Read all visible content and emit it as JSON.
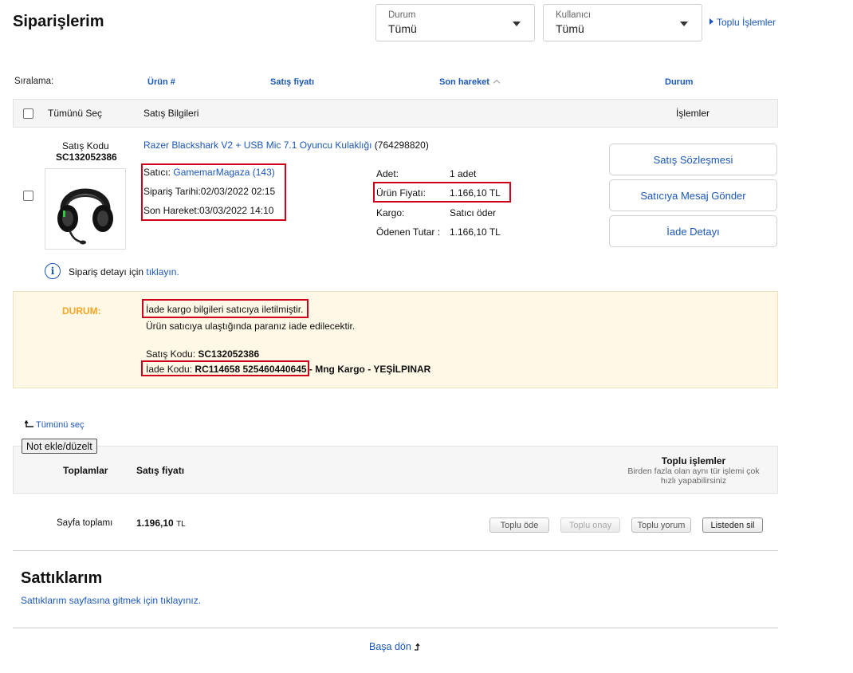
{
  "header": {
    "title": "Siparişlerim",
    "status_filter": {
      "label": "Durum",
      "value": "Tümü"
    },
    "user_filter": {
      "label": "Kullanıcı",
      "value": "Tümü"
    },
    "bulk_actions_link": "Toplu İşlemler"
  },
  "sorting": {
    "label": "Sıralama:",
    "columns": [
      "Ürün #",
      "Satış fiyatı",
      "Son hareket",
      "Durum"
    ]
  },
  "table_header": {
    "select_all": "Tümünü Seç",
    "sale_info": "Satış Bilgileri",
    "actions": "İşlemler"
  },
  "order": {
    "sale_code_label": "Satış Kodu",
    "sale_code": "SC132052386",
    "product_title": "Razer Blackshark V2 + USB Mic 7.1 Oyuncu Kulaklığı",
    "product_id": "(764298820)",
    "seller_label": "Satıcı:",
    "seller_name": "GamemarMagaza (143)",
    "order_date": "Sipariş Tarihi:02/03/2022 02:15",
    "last_action": "Son Hareket:03/03/2022 14:10",
    "details": [
      {
        "label": "Adet:",
        "value": "1 adet"
      },
      {
        "label": "Ürün Fiyatı:",
        "value": "1.166,10 TL"
      },
      {
        "label": "Kargo:",
        "value": "Satıcı öder"
      },
      {
        "label": "Ödenen Tutar :",
        "value": "1.166,10 TL"
      }
    ],
    "buttons": [
      "Satış Sözleşmesi",
      "Satıcıya Mesaj Gönder",
      "İade Detayı"
    ],
    "detail_prompt": "Sipariş detayı için",
    "detail_link": "tıklayın."
  },
  "status": {
    "label": "DURUM:",
    "line1": "İade kargo bilgileri satıcıya iletilmiştir.",
    "line2": "Ürün satıcıya ulaştığında paranız iade edilecektir.",
    "sale_code_label": "Satış Kodu:",
    "sale_code": "SC132052386",
    "return_code_label": "İade Kodu:",
    "return_code": "RC114658 525460440645",
    "carrier": "- Mng Kargo - YEŞİLPINAR"
  },
  "footer_actions": {
    "select_all_link": "Tümünü seç",
    "note_button": "Not ekle/düzelt",
    "totals_label": "Toplamlar",
    "price_label": "Satış fiyatı",
    "bulk_title": "Toplu işlemler",
    "bulk_desc1": "Birden fazla olan aynı tür işlemi çok",
    "bulk_desc2": "hızlı yapabilirsiniz",
    "page_total_label": "Sayfa toplamı",
    "page_total_value": "1.196,10",
    "page_total_currency": "TL",
    "buttons": [
      "Toplu öde",
      "Toplu onay",
      "Toplu yorum",
      "Listeden sil"
    ]
  },
  "sales": {
    "title": "Sattıklarım",
    "link": "Sattıklarım sayfasına gitmek için tıklayınız."
  },
  "back_to_top": "Başa dön"
}
